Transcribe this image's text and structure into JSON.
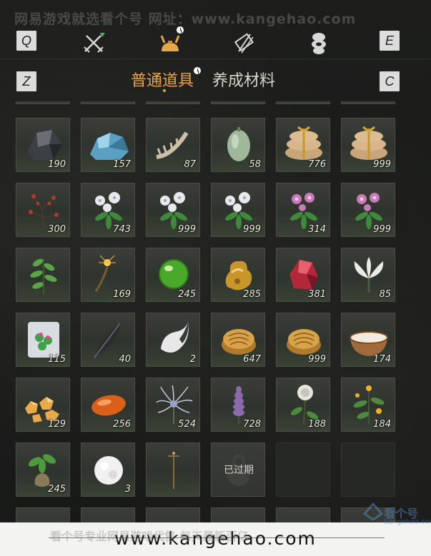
{
  "watermark_top": "网易游戏就选看个号 网址：www.kangehao.com",
  "keys": {
    "q": "Q",
    "e": "E",
    "z": "Z",
    "c": "C"
  },
  "nav_icons": [
    "crossed-swords-icon",
    "bundle-bag-icon",
    "scroll-icon",
    "stones-icon"
  ],
  "tabs": [
    {
      "label": "普通道具",
      "active": true
    },
    {
      "label": "养成材料",
      "active": false
    }
  ],
  "items": [
    {
      "icon": "black-ore-icon",
      "count": "190"
    },
    {
      "icon": "blue-crystal-ore-icon",
      "count": "157"
    },
    {
      "icon": "bone-spine-icon",
      "count": "87"
    },
    {
      "icon": "green-gourd-icon",
      "count": "58"
    },
    {
      "icon": "tied-sacks-icon",
      "count": "776"
    },
    {
      "icon": "tied-sacks-icon",
      "count": "999"
    },
    {
      "icon": "red-berry-branch-icon",
      "count": "300"
    },
    {
      "icon": "white-flower-herb-icon",
      "count": "743"
    },
    {
      "icon": "white-flower-herb-icon",
      "count": "999"
    },
    {
      "icon": "white-flower-herb-icon",
      "count": "999"
    },
    {
      "icon": "pink-flower-herb-icon",
      "count": "314"
    },
    {
      "icon": "pink-flower-herb-icon",
      "count": "999"
    },
    {
      "icon": "green-leaf-sprig-icon",
      "count": ""
    },
    {
      "icon": "sparkler-twig-icon",
      "count": "169"
    },
    {
      "icon": "green-jade-orb-icon",
      "count": "245"
    },
    {
      "icon": "gold-nugget-icon",
      "count": "285"
    },
    {
      "icon": "red-crystal-icon",
      "count": "381"
    },
    {
      "icon": "white-lily-icon",
      "count": "85"
    },
    {
      "icon": "jade-block-icon",
      "count": "115"
    },
    {
      "icon": "black-feather-icon",
      "count": "40"
    },
    {
      "icon": "white-fur-tuft-icon",
      "count": "2"
    },
    {
      "icon": "gold-ingot-icon",
      "count": "647"
    },
    {
      "icon": "gold-ingot-icon",
      "count": "999"
    },
    {
      "icon": "milk-bowl-icon",
      "count": "174"
    },
    {
      "icon": "amber-pieces-icon",
      "count": "129"
    },
    {
      "icon": "orange-seed-icon",
      "count": "256"
    },
    {
      "icon": "spider-lily-icon",
      "count": "524"
    },
    {
      "icon": "purple-spike-flower-icon",
      "count": "728"
    },
    {
      "icon": "white-rose-icon",
      "count": "188"
    },
    {
      "icon": "yellow-flower-herb-icon",
      "count": "184"
    },
    {
      "icon": "root-plant-icon",
      "count": "245"
    },
    {
      "icon": "snowball-icon",
      "count": "3"
    },
    {
      "icon": "candle-stand-icon",
      "count": ""
    },
    {
      "icon": "expired-bag-icon",
      "count": "",
      "label": "已过期"
    },
    {
      "icon": "",
      "count": ""
    },
    {
      "icon": "",
      "count": ""
    }
  ],
  "footer": {
    "site": "www.kangehao.com",
    "watermark": "看个号专业网易游戏代售 每天最新百亿",
    "logo_text": "看个号",
    "logo_sub": "kangehao.com"
  },
  "colors": {
    "active_tab": "#e6a64a",
    "cell_bg": "#353833",
    "background": "#1c1d1c"
  }
}
